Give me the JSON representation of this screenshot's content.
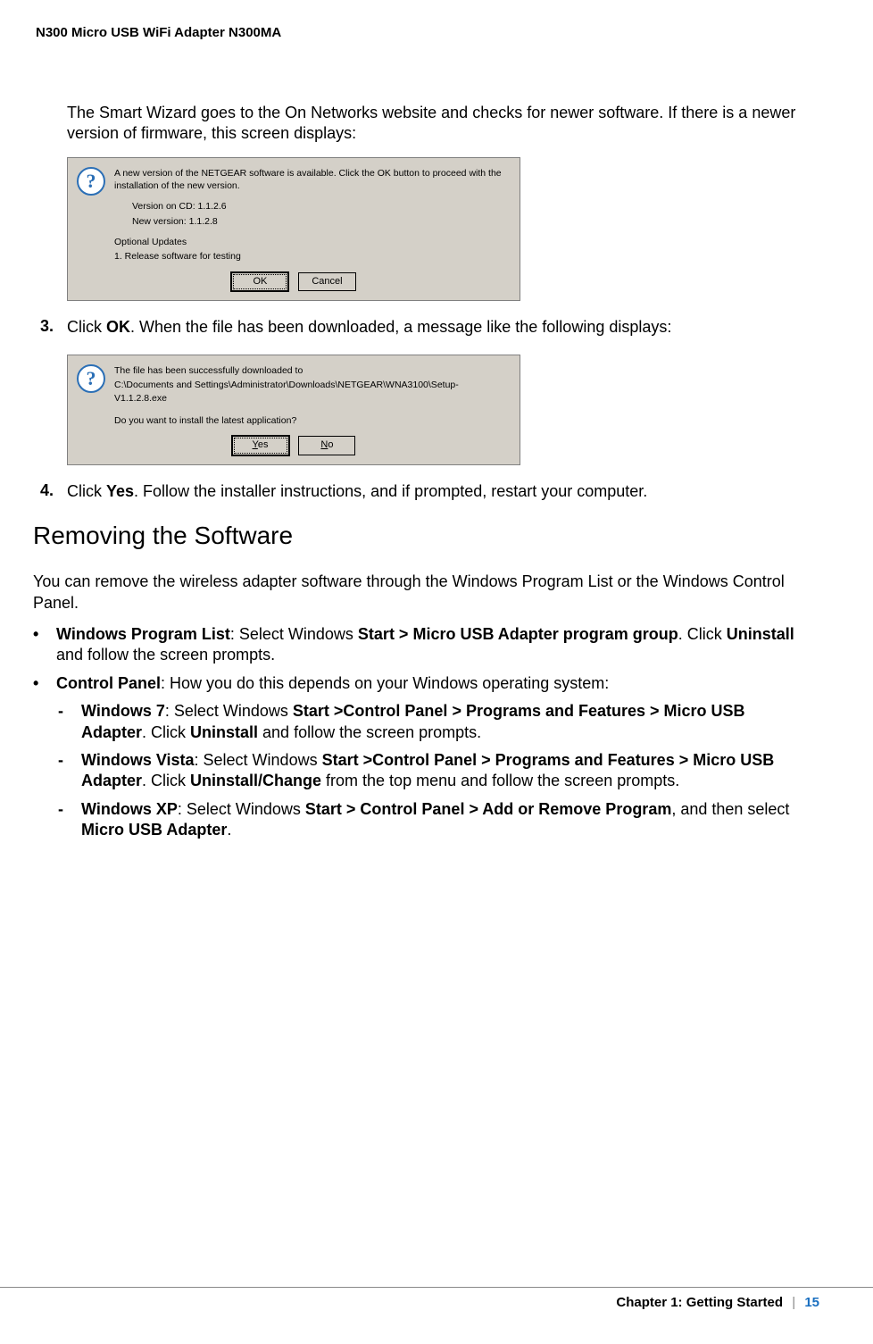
{
  "header": {
    "title": "N300 Micro USB WiFi Adapter N300MA"
  },
  "intro": "The Smart Wizard goes to the On Networks website and checks for newer software. If there is a newer version of firmware, this screen displays:",
  "dialog1": {
    "message": "A new version of the NETGEAR software is available. Click the OK button to proceed with the installation of the new version.",
    "version_cd": "Version on CD: 1.1.2.6",
    "version_new": "New version: 1.1.2.8",
    "optional_label": "Optional Updates",
    "optional_item": "1. Release software for testing",
    "buttons": {
      "ok": "OK",
      "cancel": "Cancel"
    }
  },
  "step3": {
    "num": "3.",
    "prefix": "Click ",
    "bold": "OK",
    "suffix": ". When the file has been downloaded, a message like the following displays:"
  },
  "dialog2": {
    "line1": "The file has been successfully downloaded to",
    "line2": "C:\\Documents and Settings\\Administrator\\Downloads\\NETGEAR\\WNA3100\\Setup-V1.1.2.8.exe",
    "line3": "Do you want to install the latest application?",
    "buttons": {
      "yes_u": "Y",
      "yes_rest": "es",
      "no_u": "N",
      "no_rest": "o"
    }
  },
  "step4": {
    "num": "4.",
    "prefix": "Click ",
    "bold": "Yes",
    "suffix": ". Follow the installer instructions, and if prompted, restart your computer."
  },
  "section_heading": "Removing the Software",
  "removing_intro": "You can remove the wireless adapter software through the Windows Program List or the Windows Control Panel.",
  "bullet1": {
    "b1": "Windows Program List",
    "t1": ": Select Windows ",
    "b2": "Start > Micro USB Adapter program group",
    "t2": ". Click ",
    "b3": "Uninstall",
    "t3": " and follow the screen prompts."
  },
  "bullet2": {
    "b1": "Control Panel",
    "t1": ": How you do this depends on your Windows operating system:"
  },
  "sub1": {
    "b1": "Windows 7",
    "t1": ": Select Windows ",
    "b2": "Start >Control Panel > Programs and Features > Micro USB Adapter",
    "t2": ". Click ",
    "b3": "Uninstall",
    "t3": " and follow the screen prompts."
  },
  "sub2": {
    "b1": "Windows Vista",
    "t1": ": Select Windows ",
    "b2": "Start >Control Panel > Programs and Features > Micro USB Adapter",
    "t2": ". Click ",
    "b3": "Uninstall/Change",
    "t3": " from the top menu and follow the screen prompts."
  },
  "sub3": {
    "b1": "Windows XP",
    "t1": ": Select Windows ",
    "b2": "Start > Control Panel > Add or Remove Program",
    "t2": ", and then select ",
    "b3": "Micro USB Adapter",
    "t3": "."
  },
  "footer": {
    "chapter": "Chapter 1:  Getting Started",
    "sep": "|",
    "page": "15"
  }
}
